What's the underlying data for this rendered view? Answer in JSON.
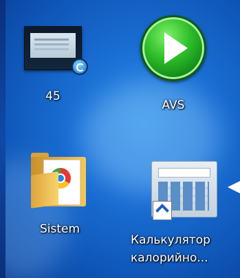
{
  "desktop": {
    "icons": [
      {
        "label": "45",
        "icon": "video-file-icon"
      },
      {
        "label": "AVS",
        "icon": "play-button-icon"
      },
      {
        "label": "Sistem",
        "icon": "folder-icon"
      },
      {
        "label_line1": "Калькулятор",
        "label_line2": "калорийно...",
        "icon": "calculator-icon"
      }
    ]
  },
  "colors": {
    "background": "#1a6fd4",
    "avs_green": "#2fbf2a",
    "label_text": "#ffffff"
  }
}
